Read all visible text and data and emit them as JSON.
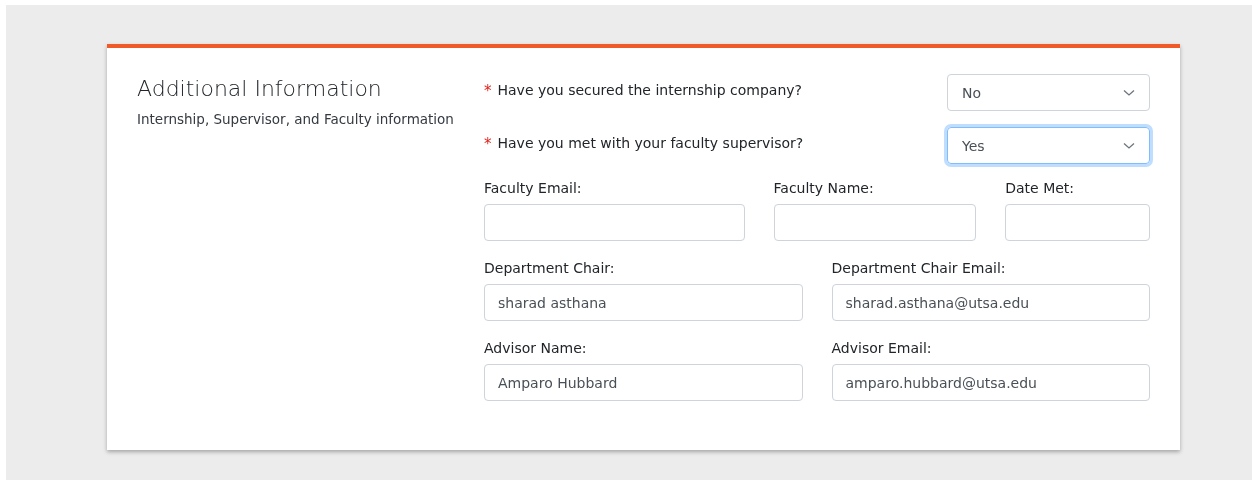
{
  "section": {
    "title": "Additional Information",
    "subtitle": "Internship, Supervisor, and Faculty information"
  },
  "questions": [
    {
      "label": "Have you secured the internship company?",
      "required_mark": "*",
      "value": "No",
      "focused": false
    },
    {
      "label": "Have you met with your faculty supervisor?",
      "required_mark": "*",
      "value": "Yes",
      "focused": true
    }
  ],
  "field_rows": [
    [
      {
        "label": "Faculty Email:"
      },
      {
        "label": "Faculty Name:"
      },
      {
        "label": "Date Met:"
      }
    ],
    [
      {
        "label": "Department Chair:",
        "value": "sharad asthana"
      },
      {
        "label": "Department Chair Email:",
        "value": "sharad.asthana@utsa.edu"
      }
    ],
    [
      {
        "label": "Advisor Name:",
        "value": "Amparo Hubbard"
      },
      {
        "label": "Advisor Email:",
        "value": "amparo.hubbard@utsa.edu"
      }
    ]
  ]
}
